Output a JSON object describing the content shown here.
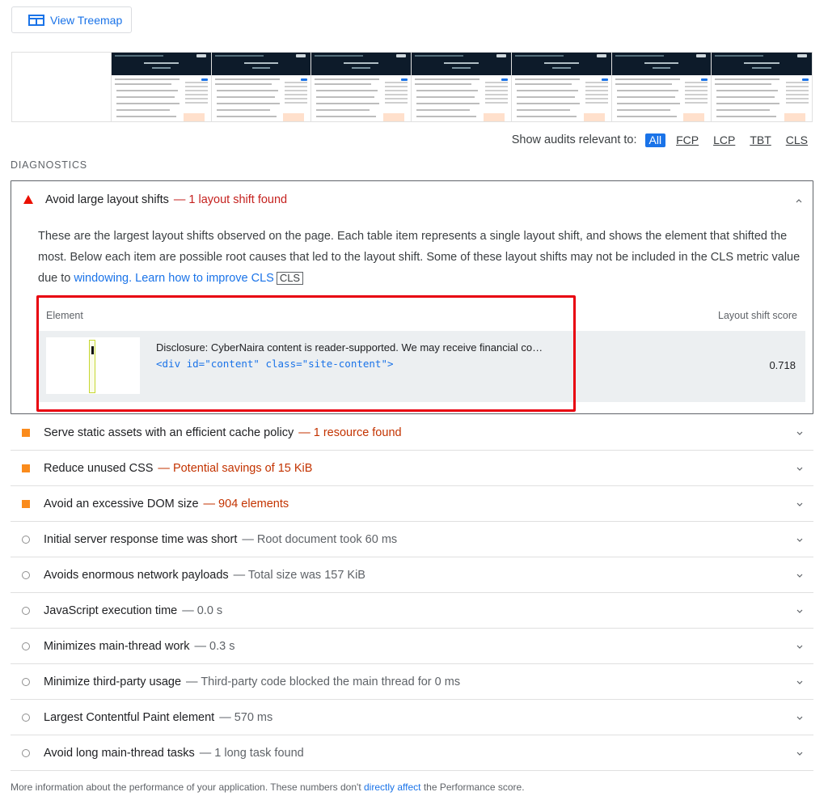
{
  "treemap": {
    "label": "View Treemap"
  },
  "filmstrip": {
    "frame_count": 7
  },
  "filter": {
    "label": "Show audits relevant to:",
    "chips": [
      "All",
      "FCP",
      "LCP",
      "TBT",
      "CLS"
    ]
  },
  "diagnostics": {
    "title": "DIAGNOSTICS"
  },
  "open_audit": {
    "title": "Avoid large layout shifts",
    "summary": "— 1 layout shift found",
    "description": "These are the largest layout shifts observed on the page. Each table item represents a single layout shift, and shows the element that shifted the most. Below each item are possible root causes that led to the layout shift. Some of these layout shifts may not be included in the CLS metric value due to",
    "link_windowing": "windowing.",
    "link_learn": "Learn how to improve CLS",
    "badge": "CLS",
    "table": {
      "col_element": "Element",
      "col_score": "Layout shift score",
      "row_text": "Disclosure: CyberNaira content is reader-supported. We may receive financial co…",
      "row_code": "<div id=\"content\" class=\"site-content\">",
      "row_score": "0.718"
    }
  },
  "audits": [
    {
      "kind": "warn",
      "title": "Serve static assets with an efficient cache policy",
      "summary": "— 1 resource found"
    },
    {
      "kind": "warn",
      "title": "Reduce unused CSS",
      "summary": "— Potential savings of 15 KiB"
    },
    {
      "kind": "warn",
      "title": "Avoid an excessive DOM size",
      "summary": "— 904 elements"
    },
    {
      "kind": "info",
      "title": "Initial server response time was short",
      "summary": "— Root document took 60 ms"
    },
    {
      "kind": "info",
      "title": "Avoids enormous network payloads",
      "summary": "— Total size was 157 KiB"
    },
    {
      "kind": "info",
      "title": "JavaScript execution time",
      "summary": "— 0.0 s"
    },
    {
      "kind": "info",
      "title": "Minimizes main-thread work",
      "summary": "— 0.3 s"
    },
    {
      "kind": "info",
      "title": "Minimize third-party usage",
      "summary": "— Third-party code blocked the main thread for 0 ms"
    },
    {
      "kind": "info",
      "title": "Largest Contentful Paint element",
      "summary": "— 570 ms"
    },
    {
      "kind": "info",
      "title": "Avoid long main-thread tasks",
      "summary": "— 1 long task found"
    }
  ],
  "footer": {
    "before": "More information about the performance of your application. These numbers don't",
    "link": "directly affect",
    "after": "the Performance score."
  },
  "colors": {
    "accent": "#1a73e8",
    "fail": "#eb0f00",
    "average": "#fa8b1c",
    "highlight": "#e8000f"
  }
}
